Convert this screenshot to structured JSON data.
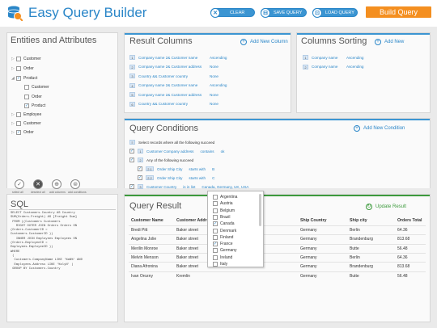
{
  "app": {
    "title": "Easy Query Builder"
  },
  "toolbar": {
    "clear": "CLEAR",
    "save": "SAVE QUERY",
    "load": "LOAD QUERY",
    "build": "Build Query"
  },
  "entities": {
    "title": "Entities and Attributes",
    "items": [
      {
        "label": "Customer",
        "checked": false,
        "expand": "▷"
      },
      {
        "label": "Order",
        "checked": false,
        "expand": "▷"
      },
      {
        "label": "Product",
        "checked": true,
        "expand": "◢"
      },
      {
        "label": "Customer",
        "checked": false,
        "expand": ""
      },
      {
        "label": "Order",
        "checked": false,
        "expand": ""
      },
      {
        "label": "Product",
        "checked": true,
        "expand": ""
      },
      {
        "label": "Employee",
        "checked": false,
        "expand": "▷"
      },
      {
        "label": "Customer",
        "checked": false,
        "expand": "▷"
      },
      {
        "label": "Order",
        "checked": true,
        "expand": "▷"
      }
    ],
    "tools": [
      "select all",
      "deselect all",
      "add columns",
      "add conditions"
    ]
  },
  "result_columns": {
    "title": "Result Columns",
    "add": "Add New Column",
    "rows": [
      {
        "n": "1",
        "field": "Company name 2& Customer name",
        "sort": "Ascending"
      },
      {
        "n": "2",
        "field": "Company name 2& Customer address",
        "sort": "None"
      },
      {
        "n": "3",
        "field": "Country && Customer country",
        "sort": "None"
      },
      {
        "n": "4",
        "field": "Company name 2& Customer name",
        "sort": "Ascending"
      },
      {
        "n": "5",
        "field": "Company name 2& Customer address",
        "sort": "None"
      },
      {
        "n": "6",
        "field": "Country && Customer country",
        "sort": "None"
      }
    ]
  },
  "sorting": {
    "title": "Columns Sorting",
    "add": "Add New",
    "rows": [
      {
        "n": "1",
        "field": "Company name",
        "sort": "Ascending"
      },
      {
        "n": "2",
        "field": "Company name",
        "sort": "Ascending"
      }
    ]
  },
  "conditions": {
    "title": "Query Conditions",
    "add": "Add New Condition",
    "intro": "Select records where all the following succeed",
    "rows": [
      {
        "n": "1",
        "field": "Customer Company address",
        "op": "contains",
        "val": "ok",
        "indent": 0,
        "type": "cond"
      },
      {
        "n": "2",
        "text": "Any of the following succeed",
        "indent": 0,
        "type": "group"
      },
      {
        "n": "2.1",
        "field": "Order Ship City",
        "op": "starts with",
        "val": "B",
        "indent": 1,
        "type": "cond"
      },
      {
        "n": "2.2",
        "field": "Order Ship City",
        "op": "starts with",
        "val": "C",
        "indent": 1,
        "type": "cond"
      },
      {
        "n": "3",
        "field": "Customer Country",
        "op": "is in list",
        "val": "Canada, Germany, UK, USA",
        "indent": 0,
        "type": "cond"
      }
    ]
  },
  "countries": [
    {
      "name": "Argentina",
      "checked": false
    },
    {
      "name": "Austria",
      "checked": false
    },
    {
      "name": "Belgium",
      "checked": false
    },
    {
      "name": "Brazil",
      "checked": false
    },
    {
      "name": "Canada",
      "checked": true
    },
    {
      "name": "Denmark",
      "checked": false
    },
    {
      "name": "Finland",
      "checked": false
    },
    {
      "name": "France",
      "checked": true
    },
    {
      "name": "Germany",
      "checked": false
    },
    {
      "name": "Ireland",
      "checked": false
    },
    {
      "name": "Italy",
      "checked": false
    }
  ],
  "sql": {
    "title": "SQL",
    "text": "SELECT Customers.Country AS Country\nSUM(Orders.Freight) AS [Freight Sum]\n FROM ((Customers Customers\n   RIGHT OUTER JOIN Orders Orders ON\n(Orders.CustomerID =\nCustomers.CustomerID ))\n   INNER JOIN Employees Employees ON\n(Orders.EmployeeID =\nEmployees.EmployeeID ))\nWHERE\n (\n  Customers.CompanyName LIKE '%aN%' AND\n  Employees.Address LIKE '%slyN' )\n GROUP BY Customers.Country"
  },
  "result": {
    "title": "Query Result",
    "update": "Update Result",
    "headers": [
      "Customer Name",
      "Customer Address",
      "Ship Country",
      "Ship city",
      "Orders Total"
    ],
    "rows": [
      [
        "Bredi Pitt",
        "Baker street",
        "Germany",
        "Berlin",
        "64.36"
      ],
      [
        "Angelina Jolie",
        "Baker street",
        "Germany",
        "Brandenburg",
        "813.68"
      ],
      [
        "Merilin Monroe",
        "Baker street",
        "Germany",
        "Butte",
        "56.48"
      ],
      [
        "Melvin Menson",
        "Baker street",
        "Germany",
        "Berlin",
        "64.36"
      ],
      [
        "Diana Afronina",
        "Baker street",
        "Germany",
        "Brandenburg",
        "813.68"
      ],
      [
        "Ivan Orozny",
        "Kremlin",
        "Germany",
        "Butte",
        "56.48"
      ]
    ]
  }
}
